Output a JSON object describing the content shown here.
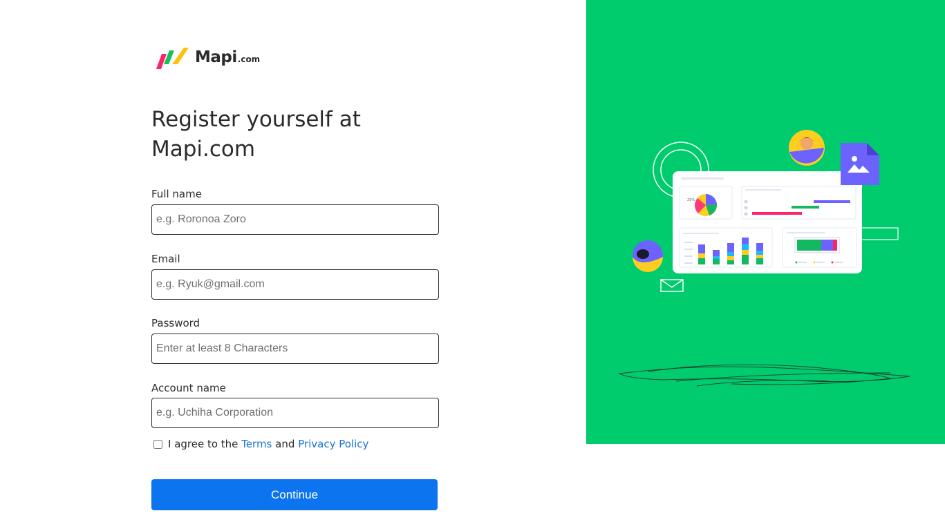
{
  "brand": {
    "name": "Mapi",
    "tld": ".com",
    "colors": {
      "red": "#ff2266",
      "green": "#16c05a",
      "yellow": "#ffc107"
    }
  },
  "form": {
    "title": "Register yourself at Mapi.com",
    "fields": [
      {
        "label": "Full name",
        "placeholder": "e.g. Roronoa Zoro"
      },
      {
        "label": "Email",
        "placeholder": "e.g. Ryuk@gmail.com"
      },
      {
        "label": "Password",
        "placeholder": "Enter at least 8 Characters"
      },
      {
        "label": "Account name",
        "placeholder": "e.g. Uchiha Corporation"
      }
    ],
    "agree": {
      "prefix": "I agree to the",
      "terms": "Terms",
      "conjunction": "and",
      "privacy": "Privacy Policy",
      "checked": false
    },
    "submit_label": "Continue"
  },
  "illustration": {
    "background": "#00cc6e",
    "pie_label": "25%",
    "icons": [
      "avatar-icon",
      "image-file-icon",
      "envelope-icon",
      "pie-chart-icon",
      "bar-chart-icon"
    ]
  },
  "colors": {
    "primary": "#0d74ef",
    "link": "#1a6fd8",
    "text": "#2b2b2b"
  }
}
